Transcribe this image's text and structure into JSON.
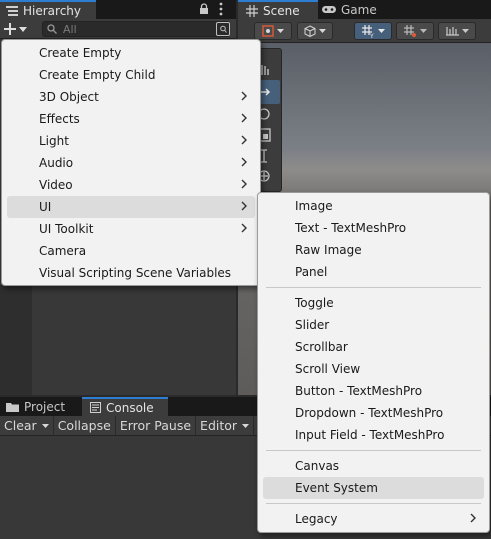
{
  "hierarchy": {
    "tab_label": "Hierarchy",
    "search_placeholder": "All"
  },
  "scene": {
    "scene_tab_label": "Scene",
    "game_tab_label": "Game"
  },
  "console": {
    "project_tab_label": "Project",
    "console_tab_label": "Console",
    "clear_label": "Clear",
    "collapse_label": "Collapse",
    "error_pause_label": "Error Pause",
    "editor_label": "Editor"
  },
  "create_menu": {
    "items": [
      {
        "label": "Create Empty"
      },
      {
        "label": "Create Empty Child"
      },
      {
        "label": "3D Object"
      },
      {
        "label": "Effects"
      },
      {
        "label": "Light"
      },
      {
        "label": "Audio"
      },
      {
        "label": "Video"
      },
      {
        "label": "UI"
      },
      {
        "label": "UI Toolkit"
      },
      {
        "label": "Camera"
      },
      {
        "label": "Visual Scripting Scene Variables"
      }
    ]
  },
  "ui_submenu": {
    "items": [
      {
        "label": "Image"
      },
      {
        "label": "Text - TextMeshPro"
      },
      {
        "label": "Raw Image"
      },
      {
        "label": "Panel"
      },
      {
        "label": "Toggle"
      },
      {
        "label": "Slider"
      },
      {
        "label": "Scrollbar"
      },
      {
        "label": "Scroll View"
      },
      {
        "label": "Button - TextMeshPro"
      },
      {
        "label": "Dropdown - TextMeshPro"
      },
      {
        "label": "Input Field - TextMeshPro"
      },
      {
        "label": "Canvas"
      },
      {
        "label": "Event System"
      },
      {
        "label": "Legacy"
      }
    ]
  },
  "colors": {
    "accent": "#2d7dd2",
    "panel": "#383838",
    "menu_bg": "#f2f2f2",
    "menu_highlight": "#dcdcdc"
  }
}
